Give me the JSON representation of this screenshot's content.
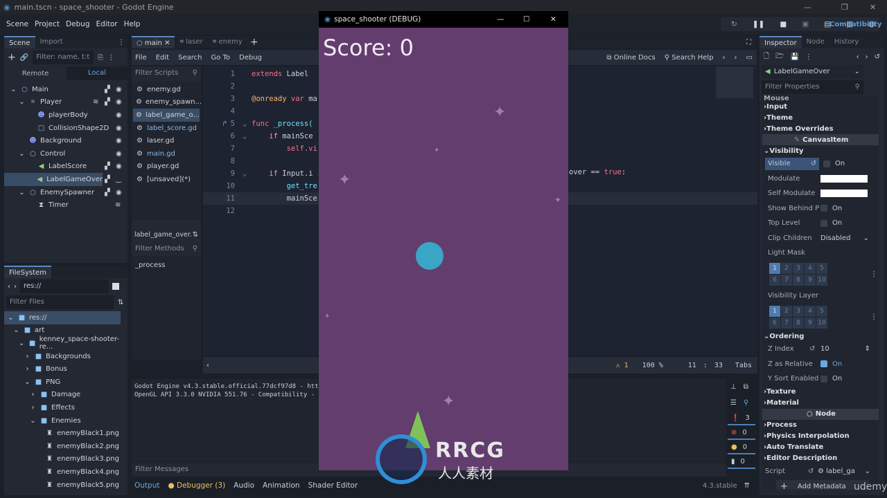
{
  "window": {
    "title": "main.tscn - space_shooter - Godot Engine"
  },
  "menu": [
    "Scene",
    "Project",
    "Debug",
    "Editor",
    "Help"
  ],
  "run_toolbar": {
    "renderer": "Compatibility"
  },
  "scene_dock": {
    "tabs": [
      "Scene",
      "Import"
    ],
    "filter_placeholder": "Filter: name, t:t",
    "remote": "Remote",
    "local": "Local",
    "nodes": [
      {
        "name": "Main",
        "icon": "node-circle",
        "depth": 0,
        "script": true,
        "visible": true
      },
      {
        "name": "Player",
        "icon": "area2d",
        "depth": 1,
        "signal": true,
        "script": true,
        "visible": true
      },
      {
        "name": "playerBody",
        "icon": "sprite",
        "depth": 2,
        "visible": true
      },
      {
        "name": "CollisionShape2D",
        "icon": "collision-shape",
        "depth": 2,
        "visible": true
      },
      {
        "name": "Background",
        "icon": "sprite",
        "depth": 1,
        "visible": true
      },
      {
        "name": "Control",
        "icon": "control",
        "depth": 1,
        "visible": true
      },
      {
        "name": "LabelScore",
        "icon": "label",
        "depth": 2,
        "script": true,
        "visible": true
      },
      {
        "name": "LabelGameOver",
        "icon": "label",
        "depth": 2,
        "script": true,
        "visible": false,
        "selected": true
      },
      {
        "name": "EnemySpawner",
        "icon": "node-circle",
        "depth": 1,
        "script": true,
        "visible": true
      },
      {
        "name": "Timer",
        "icon": "timer",
        "depth": 2,
        "signal": true
      }
    ]
  },
  "filesystem": {
    "tab": "FileSystem",
    "path": "res://",
    "filter_placeholder": "Filter Files",
    "items": [
      {
        "name": "res://",
        "depth": 0,
        "type": "folder",
        "open": true,
        "selected": true
      },
      {
        "name": "art",
        "depth": 1,
        "type": "folder",
        "open": true
      },
      {
        "name": "kenney_space-shooter-re...",
        "depth": 2,
        "type": "folder",
        "open": true
      },
      {
        "name": "Backgrounds",
        "depth": 3,
        "type": "folder"
      },
      {
        "name": "Bonus",
        "depth": 3,
        "type": "folder"
      },
      {
        "name": "PNG",
        "depth": 3,
        "type": "folder",
        "open": true
      },
      {
        "name": "Damage",
        "depth": 4,
        "type": "folder"
      },
      {
        "name": "Effects",
        "depth": 4,
        "type": "folder"
      },
      {
        "name": "Enemies",
        "depth": 4,
        "type": "folder",
        "open": true
      },
      {
        "name": "enemyBlack1.png",
        "depth": 5,
        "type": "image"
      },
      {
        "name": "enemyBlack2.png",
        "depth": 5,
        "type": "image"
      },
      {
        "name": "enemyBlack3.png",
        "depth": 5,
        "type": "image"
      },
      {
        "name": "enemyBlack4.png",
        "depth": 5,
        "type": "image"
      },
      {
        "name": "enemyBlack5.png",
        "depth": 5,
        "type": "image"
      }
    ]
  },
  "editor_tabs": [
    {
      "label": "main",
      "active": true
    },
    {
      "label": "laser"
    },
    {
      "label": "enemy"
    }
  ],
  "script_menu": [
    "File",
    "Edit",
    "Search",
    "Go To",
    "Debug"
  ],
  "script_toolbar": {
    "online_docs": "Online Docs",
    "search_help": "Search Help"
  },
  "scripts": {
    "filter_placeholder": "Filter Scripts",
    "items": [
      "enemy.gd",
      "enemy_spawn...",
      "label_game_o...",
      "label_score.gd",
      "laser.gd",
      "main.gd",
      "player.gd",
      "[unsaved](*)"
    ],
    "selected": 2,
    "current": "label_game_over.",
    "methods_placeholder": "Filter Methods",
    "methods": [
      "_process"
    ]
  },
  "code": {
    "lines": [
      [
        {
          "t": "extends ",
          "c": "kw"
        },
        {
          "t": "Label",
          "c": "tx"
        }
      ],
      [],
      [
        {
          "t": "@onready ",
          "c": "an"
        },
        {
          "t": "var ",
          "c": "kw"
        },
        {
          "t": "ma",
          "c": "tx"
        }
      ],
      [],
      [
        {
          "t": "func ",
          "c": "kw"
        },
        {
          "t": "_process(",
          "c": "fn"
        }
      ],
      [
        {
          "t": "    if ",
          "c": "ctl"
        },
        {
          "t": "mainSce",
          "c": "tx"
        }
      ],
      [
        {
          "t": "        self.vi",
          "c": "kw"
        }
      ],
      [],
      [
        {
          "t": "    if ",
          "c": "ctl"
        },
        {
          "t": "Input.i",
          "c": "tx"
        }
      ],
      [
        {
          "t": "        get_tre",
          "c": "fn"
        }
      ],
      [
        {
          "t": "        mainSce",
          "c": "tx"
        }
      ],
      []
    ],
    "line9_tail": [
      {
        "t": "over == ",
        "c": "tx"
      },
      {
        "t": "true",
        "c": "kw"
      },
      {
        "t": ":",
        "c": "tx"
      }
    ],
    "status": {
      "warnings": "1",
      "zoom": "100 %",
      "line": "11",
      "col": "33",
      "indent": "Tabs"
    }
  },
  "output": {
    "lines": [
      "Godot Engine v4.3.stable.official.77dcf97d8 - https",
      "OpenGL API 3.3.0 NVIDIA 551.76 - Compatibility - Us"
    ],
    "filter_placeholder": "Filter Messages",
    "counts": {
      "messages": "3",
      "errors": "0",
      "warnings": "0",
      "editor": "0"
    }
  },
  "bottom_tabs": [
    "Output",
    "Debugger (3)",
    "Audio",
    "Animation",
    "Shader Editor"
  ],
  "version": "4.3.stable",
  "inspector": {
    "tabs": [
      "Inspector",
      "Node",
      "History"
    ],
    "node": "LabelGameOver",
    "filter_placeholder": "Filter Properties",
    "sections_top": [
      "Mouse",
      "Input",
      "Theme",
      "Theme Overrides"
    ],
    "canvas_item": "CanvasItem",
    "visibility": "Visibility",
    "visible": {
      "label": "Visible",
      "value": "On",
      "checked": false
    },
    "modulate": "Modulate",
    "self_modulate": "Self Modulate",
    "modulate_color": "#ffffff",
    "show_behind": {
      "label": "Show Behind P",
      "value": "On"
    },
    "top_level": {
      "label": "Top Level",
      "value": "On"
    },
    "clip_children": {
      "label": "Clip Children",
      "value": "Disabled"
    },
    "light_mask": "Light Mask",
    "visibility_layer": "Visibility Layer",
    "layers": [
      "1",
      "2",
      "3",
      "4",
      "5",
      "6",
      "7",
      "8",
      "9",
      "10"
    ],
    "ordering": "Ordering",
    "z_index": {
      "label": "Z Index",
      "value": "10"
    },
    "z_relative": {
      "label": "Z as Relative",
      "value": "On",
      "checked": true
    },
    "y_sort": {
      "label": "Y Sort Enabled",
      "value": "On"
    },
    "sections_mid": [
      "Texture",
      "Material"
    ],
    "node_section": "Node",
    "sections_bottom": [
      "Process",
      "Physics Interpolation",
      "Auto Translate",
      "Editor Description"
    ],
    "script": {
      "label": "Script",
      "value": "label_ga"
    },
    "add_metadata": "Add Metadata"
  },
  "game": {
    "title": "space_shooter (DEBUG)",
    "score": "Score: 0",
    "bg": "#633d6e"
  },
  "watermark": {
    "text": "RRCG",
    "sub": "人人素材",
    "udemy": "udemy"
  }
}
